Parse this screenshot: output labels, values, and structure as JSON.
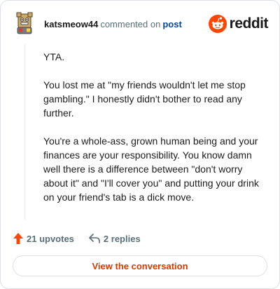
{
  "header": {
    "username": "katsmeow44",
    "action_text": "commented on",
    "post_link": "post",
    "brand": "reddit"
  },
  "comment": {
    "paragraphs": [
      "YTA.",
      "You lost me at \"my friends wouldn't let me stop gambling.\" I honestly didn't bother to read any further.",
      "You're a whole-ass, grown human being and your finances are your responsibility. You know damn well there is a difference between \"don't worry about it\" and \"I'll cover you\" and putting your drink on your friend's tab is a dick move."
    ]
  },
  "footer": {
    "upvotes": "21 upvotes",
    "replies": "2 replies"
  },
  "cta": {
    "label": "View the conversation"
  },
  "colors": {
    "accent": "#d93a00",
    "reddit_orange": "#ff4500",
    "link": "#0a449b"
  }
}
